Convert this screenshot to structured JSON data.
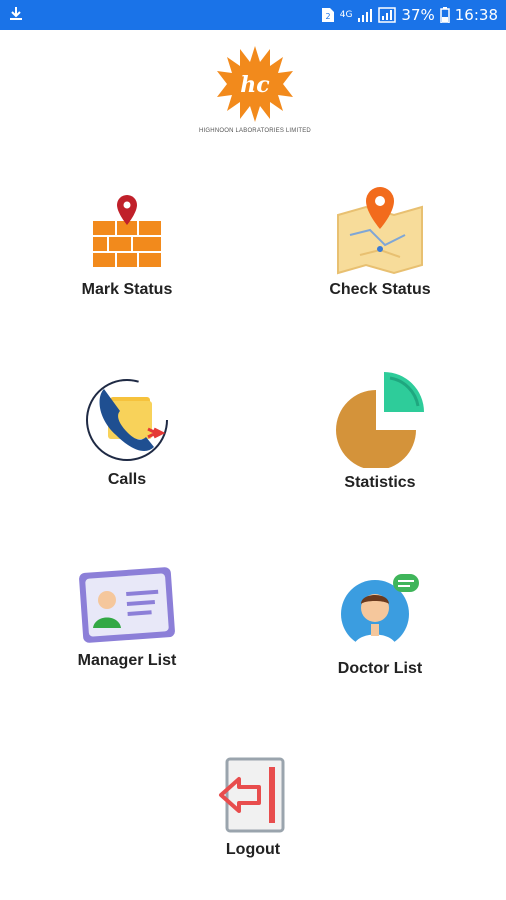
{
  "status_bar": {
    "battery_percent": "37%",
    "time": "16:38",
    "network_label": "4G",
    "icons": [
      "download-icon",
      "sim-icon",
      "network-4g-icon",
      "signal-icon",
      "battery-icon"
    ]
  },
  "logo": {
    "caption": "HIGHNOON LABORATORIES LIMITED",
    "brand_color": "#f28a1c"
  },
  "menu": {
    "mark_status": {
      "label": "Mark Status",
      "icon": "map-pin-wall-icon"
    },
    "check_status": {
      "label": "Check Status",
      "icon": "map-location-icon"
    },
    "calls": {
      "label": "Calls",
      "icon": "phone-call-icon"
    },
    "statistics": {
      "label": "Statistics",
      "icon": "pie-chart-icon"
    },
    "manager_list": {
      "label": "Manager List",
      "icon": "id-card-icon"
    },
    "doctor_list": {
      "label": "Doctor List",
      "icon": "doctor-icon"
    },
    "logout": {
      "label": "Logout",
      "icon": "logout-door-icon"
    }
  },
  "colors": {
    "status_bar": "#1a73e8",
    "accent_orange": "#f28a1c",
    "pin_red": "#c0202a",
    "pie_teal": "#2ecc9a",
    "pie_gold": "#d4933a"
  }
}
